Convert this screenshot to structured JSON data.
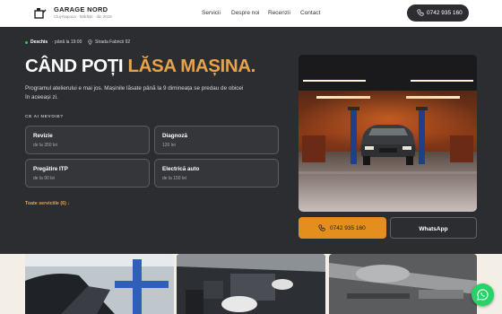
{
  "header": {
    "brand": "GARAGE NORD",
    "tagline": "Cluj-Napoca · Mărăști · din 2016",
    "nav": [
      "Servicii",
      "Despre noi",
      "Recenzii",
      "Contact"
    ],
    "call_label": "0742 935 160"
  },
  "hero": {
    "status_open": "Deschis",
    "status_hours": "· până la 19:00",
    "address": "Strada Fabricii 92",
    "headline_part1": "CÂND POȚI",
    "headline_part2": "LĂSA MAȘINA.",
    "lead": "Programul atelierului e mai jos. Mașinile lăsate până la 9 dimineața se predau de obicei în aceeași zi.",
    "section_label": "CE AI NEVOIE?",
    "services": [
      {
        "title": "Revizie",
        "price": "de la 350 lei"
      },
      {
        "title": "Diagnoză",
        "price": "120 lei"
      },
      {
        "title": "Pregătire ITP",
        "price": "de la 90 lei"
      },
      {
        "title": "Electrică auto",
        "price": "de la 150 lei"
      }
    ],
    "all_services_link": "Toate serviciile (6) ↓",
    "phone_button": "0742 935 160",
    "whatsapp_button": "WhatsApp"
  },
  "colors": {
    "background": "#2b2d30",
    "accent": "#e8a24a",
    "button_accent": "#e38e1f",
    "whatsapp": "#25d366",
    "open_dot": "#37c06a"
  },
  "icons": {
    "logo": "oil-can-icon",
    "phone": "phone-icon",
    "location": "location-pin-icon",
    "whatsapp": "whatsapp-icon"
  }
}
